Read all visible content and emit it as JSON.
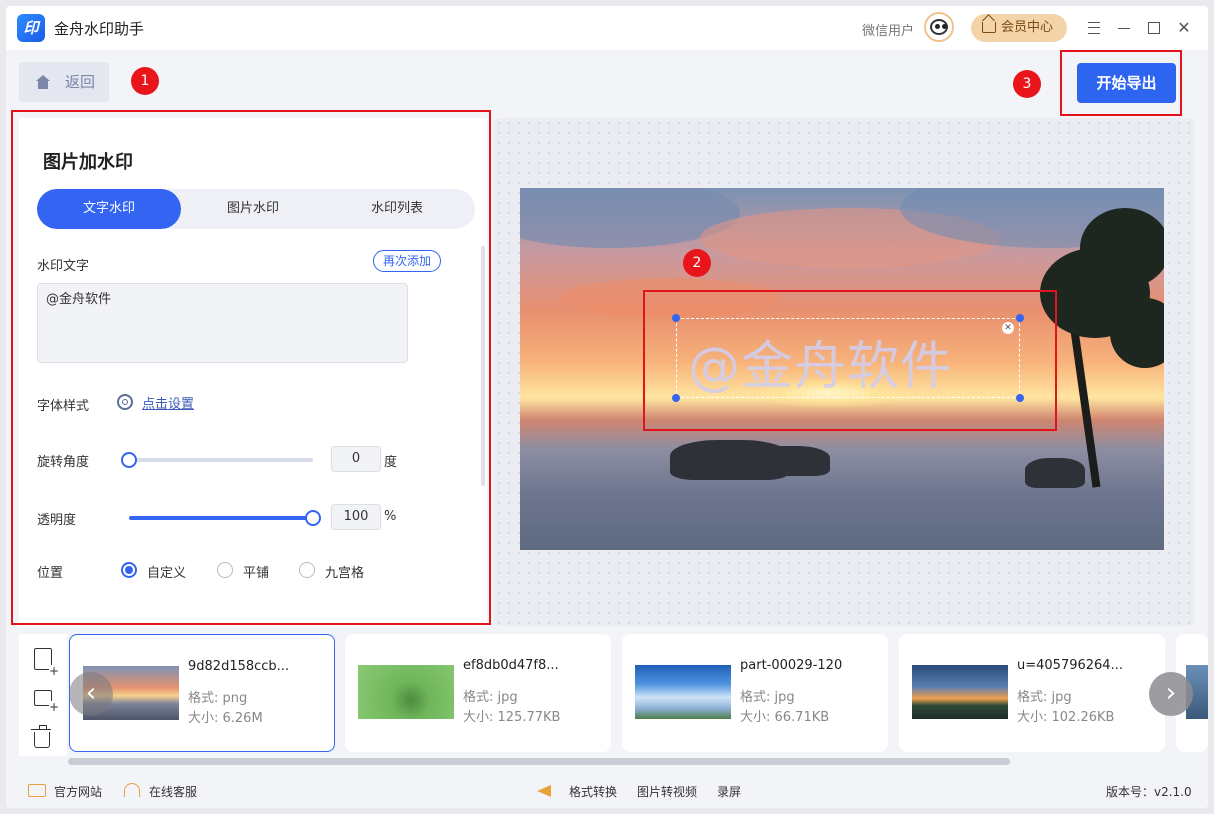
{
  "app": {
    "title": "金舟水印助手",
    "logo_text": "印"
  },
  "header": {
    "user_name": "微信用户",
    "member_label": "会员中心"
  },
  "toolbar": {
    "back_label": "返回",
    "export_label": "开始导出"
  },
  "annotations": {
    "badge1": "1",
    "badge2": "2",
    "badge3": "3"
  },
  "panel": {
    "title": "图片加水印",
    "tabs": [
      {
        "label": "文字水印",
        "active": true
      },
      {
        "label": "图片水印",
        "active": false
      },
      {
        "label": "水印列表",
        "active": false
      }
    ],
    "watermark_text_label": "水印文字",
    "readd_label": "再次添加",
    "watermark_text_value": "@金舟软件",
    "font_style_label": "字体样式",
    "font_style_link": "点击设置",
    "rotation_label": "旋转角度",
    "rotation_value": "0",
    "rotation_unit": "度",
    "opacity_label": "透明度",
    "opacity_value": "100",
    "opacity_unit": "%",
    "position_label": "位置",
    "position_options": [
      "自定义",
      "平铺",
      "九宫格"
    ],
    "position_selected": "自定义"
  },
  "preview": {
    "watermark_text": "@金舟软件"
  },
  "files": [
    {
      "name": "9d82d158ccb...",
      "format": "格式: png",
      "size": "大小: 6.26M",
      "selected": true
    },
    {
      "name": "ef8db0d47f8...",
      "format": "格式: jpg",
      "size": "大小: 125.77KB",
      "selected": false
    },
    {
      "name": "part-00029-120",
      "format": "格式: jpg",
      "size": "大小: 66.71KB",
      "selected": false
    },
    {
      "name": "u=405796264...",
      "format": "格式: jpg",
      "size": "大小: 102.26KB",
      "selected": false
    }
  ],
  "footer": {
    "website": "官方网站",
    "service": "在线客服",
    "format_convert": "格式转换",
    "image_to_video": "图片转视频",
    "record": "录屏",
    "version": "版本号：v2.1.0"
  },
  "colors": {
    "accent": "#3365f2",
    "annotation_red": "#e3131b",
    "member_bg": "#f3d4a8",
    "footer_icon": "#e8a23b"
  }
}
